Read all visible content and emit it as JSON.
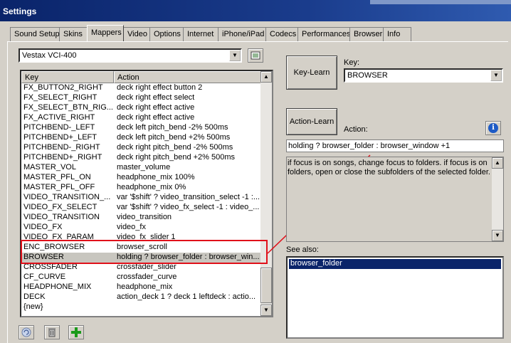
{
  "window": {
    "title": "Settings"
  },
  "tabs": [
    "Sound Setup",
    "Skins",
    "Mappers",
    "Video",
    "Options",
    "Internet",
    "iPhone/iPad",
    "Codecs",
    "Performances",
    "Browser",
    "Info"
  ],
  "active_tab": "Mappers",
  "mapper": {
    "selected": "Vestax VCI-400"
  },
  "table": {
    "columns": [
      "Key",
      "Action"
    ],
    "rows": [
      [
        "FX_BUTTON2_RIGHT",
        "deck right effect button 2"
      ],
      [
        "FX_SELECT_RIGHT",
        "deck right effect select"
      ],
      [
        "FX_SELECT_BTN_RIG...",
        "deck right effect active"
      ],
      [
        "FX_ACTIVE_RIGHT",
        "deck right effect active"
      ],
      [
        "PITCHBEND-_LEFT",
        "deck left pitch_bend -2% 500ms"
      ],
      [
        "PITCHBEND+_LEFT",
        "deck left pitch_bend +2% 500ms"
      ],
      [
        "PITCHBEND-_RIGHT",
        "deck right pitch_bend -2% 500ms"
      ],
      [
        "PITCHBEND+_RIGHT",
        "deck right pitch_bend +2% 500ms"
      ],
      [
        "MASTER_VOL",
        "master_volume"
      ],
      [
        "MASTER_PFL_ON",
        "headphone_mix 100%"
      ],
      [
        "MASTER_PFL_OFF",
        "headphone_mix 0%"
      ],
      [
        "VIDEO_TRANSITION_...",
        "var '$shift' ? video_transition_select -1 :..."
      ],
      [
        "VIDEO_FX_SELECT",
        "var '$shift' ? video_fx_select -1 : video_..."
      ],
      [
        "VIDEO_TRANSITION",
        "video_transition"
      ],
      [
        "VIDEO_FX",
        "video_fx"
      ],
      [
        "VIDEO_FX_PARAM",
        "video_fx_slider 1"
      ],
      [
        "ENC_BROWSER",
        "browser_scroll"
      ],
      [
        "BROWSER",
        "holding ? browser_folder : browser_win..."
      ],
      [
        "CROSSFADER",
        "crossfader_slider"
      ],
      [
        "CF_CURVE",
        "crossfader_curve"
      ],
      [
        "HEADPHONE_MIX",
        "headphone_mix"
      ],
      [
        "DECK",
        "action_deck 1 ? deck 1 leftdeck : actio..."
      ],
      [
        "{new}",
        ""
      ]
    ],
    "selected_index": 17
  },
  "key_learn_label": "Key-Learn",
  "key_label": "Key:",
  "key_value": "BROWSER",
  "action_learn_label": "Action-Learn",
  "action_label": "Action:",
  "action_value": "holding ? browser_folder : browser_window +1",
  "description": "if focus is on songs, change focus to folders. if focus is on folders, open or close the subfolders of the selected folder.",
  "see_also_label": "See also:",
  "see_also_items": [
    "browser_folder"
  ],
  "icons": {
    "list_toggle": "list-icon",
    "info": "info-icon",
    "refresh": "refresh-icon",
    "delete": "trash-icon",
    "add": "plus-icon"
  },
  "colors": {
    "title_bar": "#0a246a",
    "highlight": "#e0101a",
    "selection": "#0a246a"
  }
}
